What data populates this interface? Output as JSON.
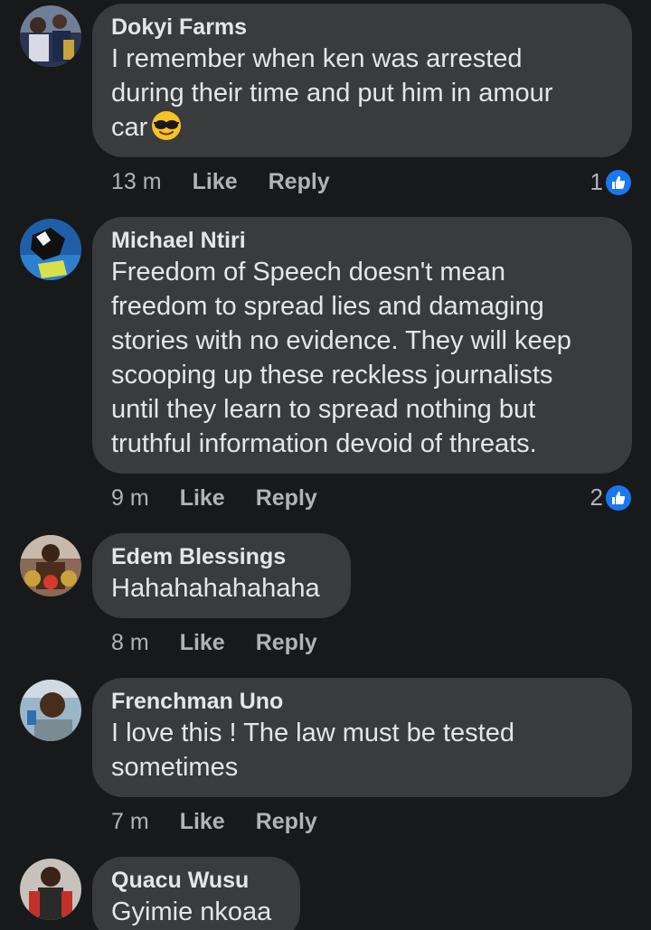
{
  "comments": [
    {
      "author": "Dokyi Farms",
      "text": "I remember when ken was arrested\nduring their time and put him in amour\ncar",
      "emoji": "smiling-face-with-sunglasses",
      "time": "13 m",
      "like_label": "Like",
      "reply_label": "Reply",
      "reaction_count": "1"
    },
    {
      "author": "Michael Ntiri",
      "text": "Freedom of Speech doesn't mean\nfreedom to spread lies and damaging\nstories with no evidence. They will keep\nscooping up these reckless journalists\nuntil they learn to spread nothing but\ntruthful information devoid of threats.",
      "time": "9 m",
      "like_label": "Like",
      "reply_label": "Reply",
      "reaction_count": "2"
    },
    {
      "author": "Edem Blessings",
      "text": "Hahahahahahaha",
      "time": "8 m",
      "like_label": "Like",
      "reply_label": "Reply"
    },
    {
      "author": "Frenchman Uno",
      "text": "I love this ! The law must be tested\nsometimes",
      "time": "7 m",
      "like_label": "Like",
      "reply_label": "Reply"
    },
    {
      "author": "Quacu Wusu",
      "text": "Gyimie nkoaa"
    }
  ],
  "colors": {
    "background": "#18191a",
    "bubble": "#3a3b3c",
    "text": "#e4e6eb",
    "secondary_text": "#b0b3b8",
    "like_badge": "#1877f2"
  }
}
